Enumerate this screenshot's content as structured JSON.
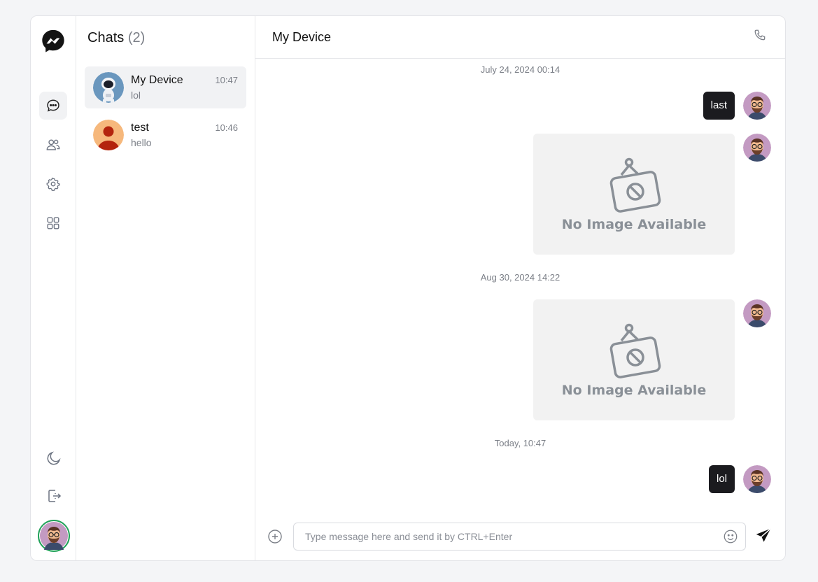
{
  "list": {
    "title": "Chats",
    "count": "(2)",
    "chats": [
      {
        "name": "My Device",
        "preview": "lol",
        "time": "10:47"
      },
      {
        "name": "test",
        "preview": "hello",
        "time": "10:46"
      }
    ]
  },
  "conversation": {
    "title": "My Device",
    "dates": [
      "July 24, 2024 00:14",
      "Aug 30, 2024 14:22",
      "Today, 10:47"
    ],
    "messages": [
      {
        "type": "text",
        "text": "last"
      },
      {
        "type": "image",
        "placeholder": "No Image Available"
      },
      {
        "type": "image",
        "placeholder": "No Image Available"
      },
      {
        "type": "text",
        "text": "lol"
      }
    ]
  },
  "composer": {
    "placeholder": "Type message here and send it by CTRL+Enter"
  },
  "icons": {
    "logo": "messenger-logo-icon",
    "nav": [
      "chat-icon",
      "contacts-icon",
      "settings-icon",
      "apps-icon"
    ],
    "bottom": [
      "moon-icon",
      "logout-icon"
    ],
    "header": "phone-icon",
    "composer": [
      "plus-circle-icon",
      "emoji-icon",
      "send-icon"
    ]
  },
  "colors": {
    "accent": "#1b1b1f",
    "online": "#22a15a",
    "muted": "#7b7f87"
  }
}
